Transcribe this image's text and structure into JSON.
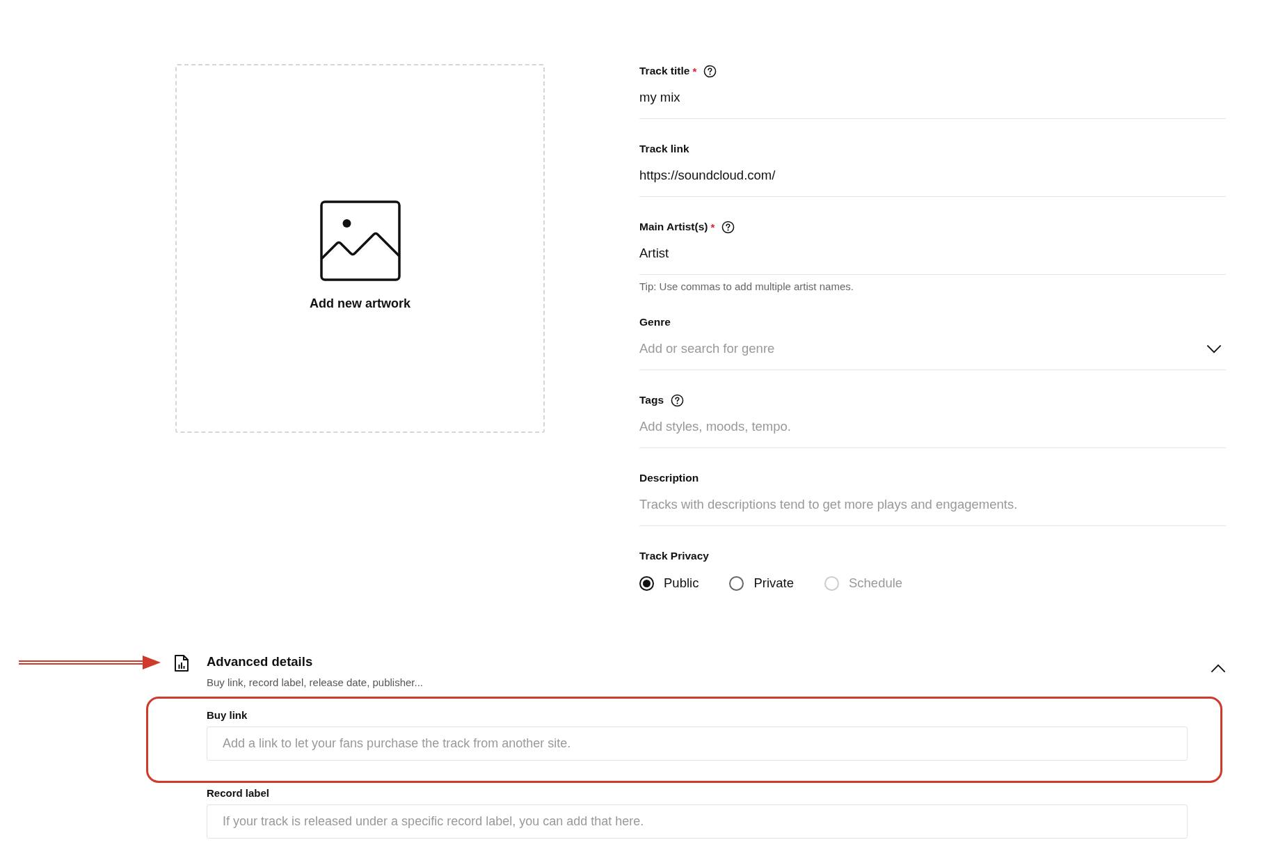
{
  "artwork": {
    "label": "Add new artwork"
  },
  "fields": [
    {
      "kind": "text",
      "label": "Track title",
      "required": true,
      "help": true,
      "value": "my mix"
    },
    {
      "kind": "text",
      "label": "Track link",
      "required": false,
      "help": false,
      "value": "https://soundcloud.com/"
    },
    {
      "kind": "text",
      "label": "Main Artist(s)",
      "required": true,
      "help": true,
      "value": "Artist",
      "hint": "Tip: Use commas to add multiple artist names."
    },
    {
      "kind": "select",
      "label": "Genre",
      "required": false,
      "help": false,
      "placeholder": "Add or search for genre"
    },
    {
      "kind": "text",
      "label": "Tags",
      "required": false,
      "help": true,
      "placeholder": "Add styles, moods, tempo."
    },
    {
      "kind": "text",
      "label": "Description",
      "required": false,
      "help": false,
      "placeholder": "Tracks with descriptions tend to get more plays and engagements."
    },
    {
      "kind": "radio",
      "label": "Track Privacy",
      "required": false,
      "help": false,
      "options": [
        {
          "label": "Public",
          "selected": true,
          "disabled": false
        },
        {
          "label": "Private",
          "selected": false,
          "disabled": false
        },
        {
          "label": "Schedule",
          "selected": false,
          "disabled": true
        }
      ]
    }
  ],
  "required_mark": "*",
  "advanced": {
    "title": "Advanced details",
    "subtitle": "Buy link, record label, release date, publisher...",
    "expanded": true,
    "fields": [
      {
        "label": "Buy link",
        "placeholder": "Add a link to let your fans purchase the track from another site.",
        "highlighted": true
      },
      {
        "label": "Record label",
        "placeholder": "If your track is released under a specific record label, you can add that here.",
        "highlighted": false
      }
    ]
  }
}
